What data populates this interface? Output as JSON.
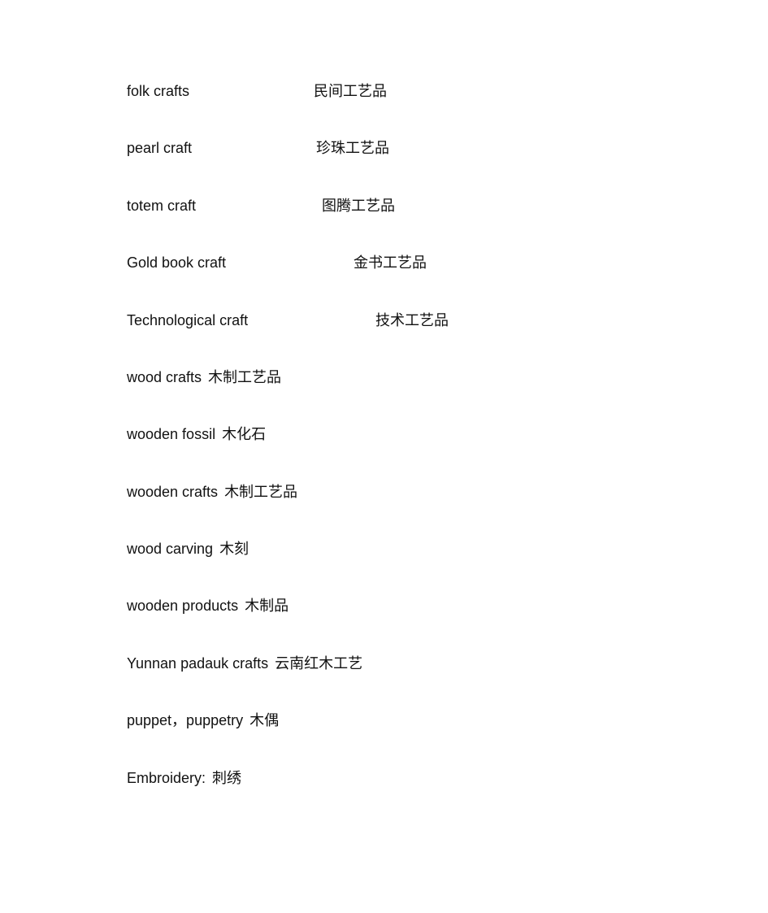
{
  "entries": [
    {
      "en": "folk crafts",
      "zh": "民间工艺品"
    },
    {
      "en": "pearl craft",
      "zh": "珍珠工艺品"
    },
    {
      "en": "totem craft",
      "zh": "图腾工艺品"
    },
    {
      "en": "Gold book craft",
      "zh": "金书工艺品"
    },
    {
      "en": "Technological craft",
      "zh": "技术工艺品"
    },
    {
      "en": "wood crafts",
      "zh": "木制工艺品"
    },
    {
      "en": "wooden fossil",
      "zh": "木化石"
    },
    {
      "en": "wooden crafts",
      "zh": "木制工艺品"
    },
    {
      "en": "wood carving",
      "zh": "木刻"
    },
    {
      "en": "wooden products",
      "zh": "木制品"
    },
    {
      "en": "Yunnan padauk crafts",
      "zh": "云南红木工艺"
    },
    {
      "en": "puppet，puppetry",
      "zh": "木偶"
    },
    {
      "en": "Embroidery:",
      "zh": "刺绣"
    }
  ]
}
